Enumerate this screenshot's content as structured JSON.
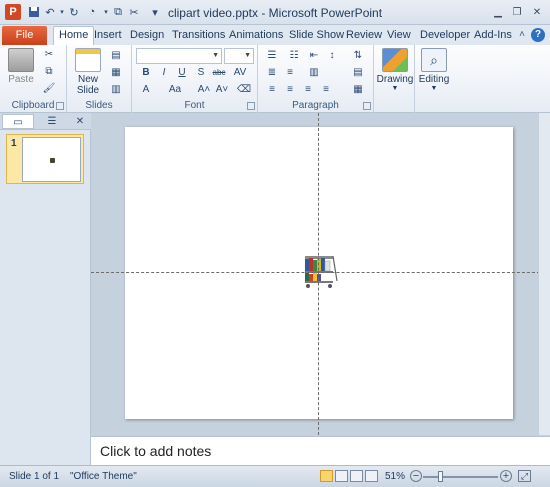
{
  "window": {
    "title": "clipart video.pptx - Microsoft PowerPoint",
    "app_icon_letter": "P"
  },
  "tabs": {
    "file": "File",
    "items": [
      "Home",
      "Insert",
      "Design",
      "Transitions",
      "Animations",
      "Slide Show",
      "Review",
      "View",
      "Developer",
      "Add-Ins"
    ],
    "active": "Home"
  },
  "ribbon": {
    "clipboard": {
      "label": "Clipboard",
      "paste": "Paste"
    },
    "slides": {
      "label": "Slides",
      "new_slide_line1": "New",
      "new_slide_line2": "Slide"
    },
    "font": {
      "label": "Font",
      "name_value": "",
      "size_value": "",
      "bold": "B",
      "italic": "I",
      "underline": "U",
      "shadow": "S",
      "strike": "abc"
    },
    "paragraph": {
      "label": "Paragraph"
    },
    "drawing": {
      "label": "Drawing"
    },
    "editing": {
      "label": "Editing"
    }
  },
  "panel": {
    "slide_number": "1"
  },
  "notes": {
    "placeholder": "Click to add notes"
  },
  "status": {
    "slide": "Slide 1 of 1",
    "theme": "\"Office Theme\"",
    "zoom": "51%"
  },
  "colors": {
    "file_tab": "#c9411b",
    "accent": "#1e395b",
    "ribbon_bg": "#e6ecf4",
    "workspace": "#c6d1de",
    "thumb_selected": "#fbe7a6"
  },
  "icons": [
    "save-icon",
    "undo-icon",
    "redo-icon",
    "minimize-icon",
    "restore-icon",
    "close-icon",
    "help-icon",
    "paste-icon",
    "cut-icon",
    "copy-icon",
    "format-painter-icon",
    "new-slide-icon",
    "drawing-icon",
    "editing-icon",
    "clipart-cart-icon"
  ]
}
